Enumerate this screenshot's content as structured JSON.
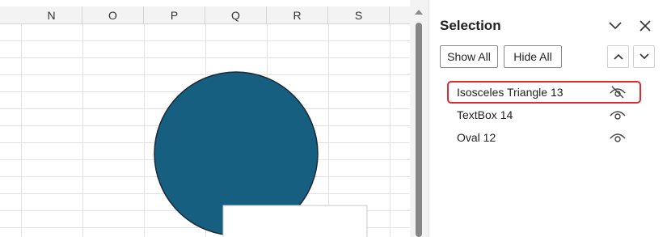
{
  "sheet": {
    "columns": [
      "N",
      "O",
      "P",
      "Q",
      "R",
      "S"
    ]
  },
  "pane": {
    "title": "Selection",
    "show_all_label": "Show All",
    "hide_all_label": "Hide All",
    "items": [
      {
        "name": "Isosceles Triangle 13",
        "visible": false,
        "selected": true
      },
      {
        "name": "TextBox 14",
        "visible": true,
        "selected": false
      },
      {
        "name": "Oval 12",
        "visible": true,
        "selected": false
      }
    ]
  },
  "colors": {
    "oval_fill": "#175f81",
    "selection_highlight": "#e0282e"
  }
}
